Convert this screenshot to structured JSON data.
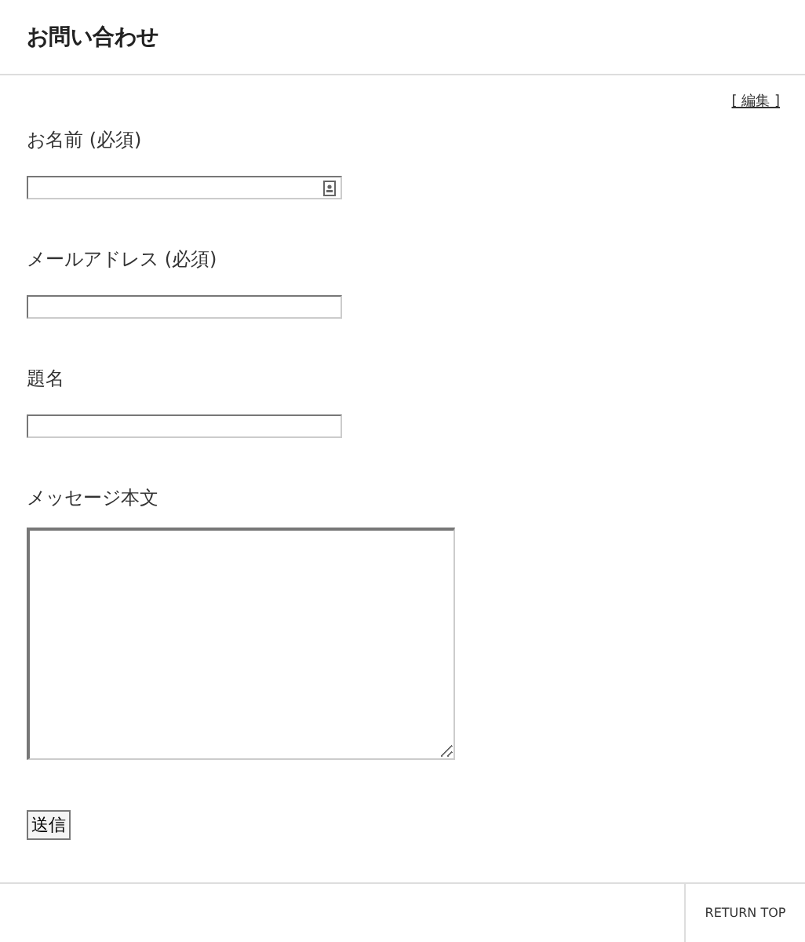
{
  "header": {
    "title": "お問い合わせ"
  },
  "edit_link": "[ 編集 ]",
  "fields": [
    {
      "label": "お名前 (必須)",
      "kind": "text",
      "autofill": true
    },
    {
      "label": "メールアドレス (必須)",
      "kind": "text",
      "autofill": false
    },
    {
      "label": "題名",
      "kind": "text",
      "autofill": false
    },
    {
      "label": "メッセージ本文",
      "kind": "textarea"
    }
  ],
  "submit": "送信",
  "footer": {
    "return_top": "RETURN TOP"
  }
}
